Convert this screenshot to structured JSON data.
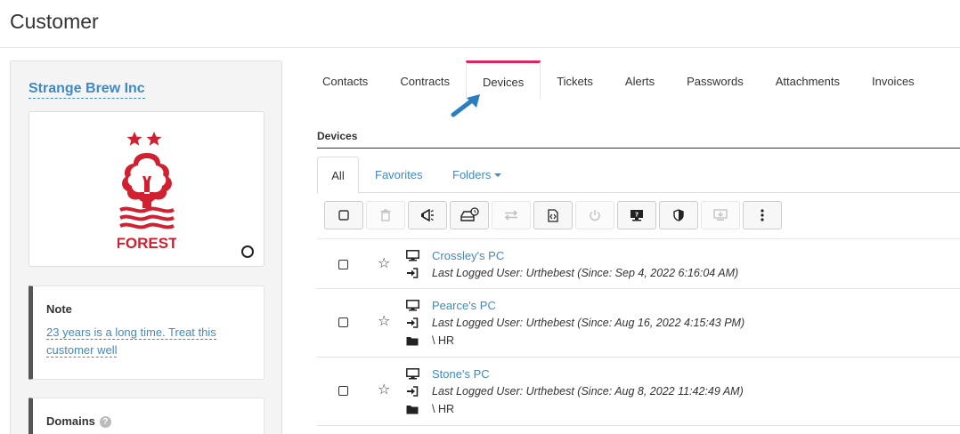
{
  "page": {
    "title": "Customer"
  },
  "customer": {
    "name": "Strange Brew Inc",
    "logo_text": "FOREST",
    "note": {
      "title": "Note",
      "text_line1": "23 years is a long time. Treat this",
      "text_line2": "customer well"
    },
    "domains": {
      "title": "Domains",
      "help": "?"
    }
  },
  "tabs": [
    {
      "label": "Contacts"
    },
    {
      "label": "Contracts"
    },
    {
      "label": "Devices",
      "active": true
    },
    {
      "label": "Tickets"
    },
    {
      "label": "Alerts"
    },
    {
      "label": "Passwords"
    },
    {
      "label": "Attachments"
    },
    {
      "label": "Invoices"
    }
  ],
  "devices_section": {
    "title": "Devices",
    "subtabs": {
      "all": "All",
      "favorites": "Favorites",
      "folders": "Folders"
    },
    "toolbar": [
      {
        "icon": "checkbox-icon"
      },
      {
        "icon": "trash-icon",
        "disabled": true
      },
      {
        "icon": "megaphone-icon"
      },
      {
        "icon": "drive-clock-icon"
      },
      {
        "icon": "transfer-icon"
      },
      {
        "icon": "file-code-icon"
      },
      {
        "icon": "power-icon",
        "disabled": true
      },
      {
        "icon": "remote-desktop-icon"
      },
      {
        "icon": "shield-icon"
      },
      {
        "icon": "download-monitor-icon",
        "disabled": true
      },
      {
        "icon": "more-vertical-icon"
      }
    ],
    "rows": [
      {
        "name": "Crossley's PC",
        "last_user": "Last Logged User: Urthebest (Since: Sep 4, 2022 6:16:04 AM)",
        "folder": ""
      },
      {
        "name": "Pearce's PC",
        "last_user": "Last Logged User: Urthebest (Since: Aug 16, 2022 4:15:43 PM)",
        "folder": "\\ HR"
      },
      {
        "name": "Stone's PC",
        "last_user": "Last Logged User: Urthebest (Since: Aug 8, 2022 11:42:49 AM)",
        "folder": "\\ HR"
      }
    ]
  },
  "colors": {
    "link": "#3f8ac2",
    "active_tab": "#e0245e",
    "logo_red": "#d1202f",
    "arrow": "#2a7fc1"
  }
}
